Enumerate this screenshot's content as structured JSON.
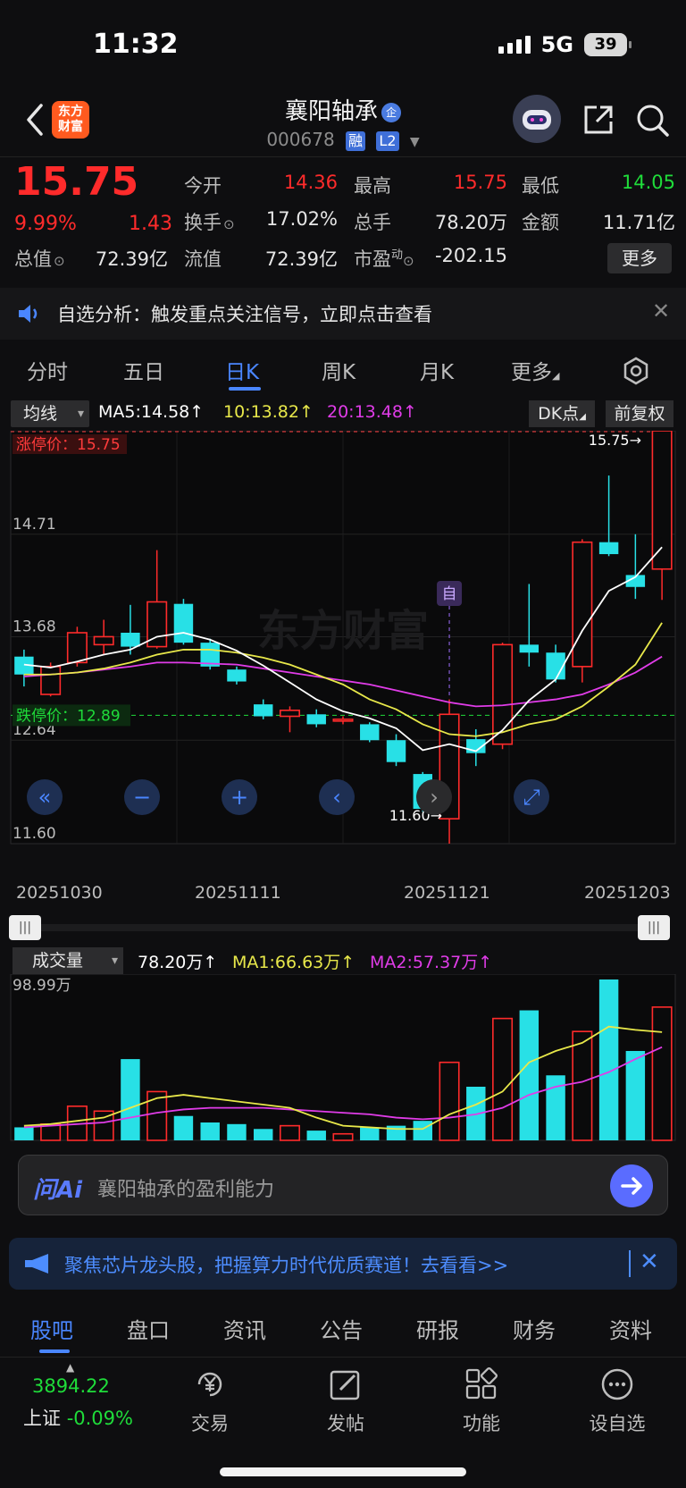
{
  "status": {
    "time": "11:32",
    "network": "5G",
    "battery": "39"
  },
  "nav": {
    "logo_line1": "东方",
    "logo_line2": "财富",
    "title": "襄阳轴承",
    "title_badge": "企",
    "code": "000678",
    "tag1": "融",
    "tag2": "L2"
  },
  "quote": {
    "price": "15.75",
    "pct": "9.99%",
    "change": "1.43",
    "open_label": "今开",
    "open": "14.36",
    "high_label": "最高",
    "high": "15.75",
    "low_label": "最低",
    "low": "14.05",
    "turnover_label": "换手",
    "turnover": "17.02%",
    "volume_label": "总手",
    "volume": "78.20万",
    "amount_label": "金额",
    "amount": "11.71亿",
    "mcap_label": "总值",
    "mcap": "72.39亿",
    "float_label": "流值",
    "float": "72.39亿",
    "pe_label": "市盈",
    "pe_sup": "动",
    "pe": "-202.15",
    "more": "更多"
  },
  "notice": {
    "text": "自选分析：触发重点关注信号，立即点击查看",
    "close": "✕"
  },
  "tabs": [
    "分时",
    "五日",
    "日K",
    "周K",
    "月K",
    "更多"
  ],
  "ma_row": {
    "select": "均线",
    "ma5": "MA5:14.58↑",
    "ma10": "10:13.82↑",
    "ma20": "20:13.48↑",
    "dk": "DK点",
    "fq": "前复权"
  },
  "kchart_labels": {
    "limit_up": "涨停价：15.75",
    "limit_down": "跌停价：12.89",
    "y1": "15.75",
    "y2": "14.71",
    "y3": "13.68",
    "y4": "12.64",
    "y5": "11.60",
    "max_mark": "15.75→",
    "min_mark": "11.60→",
    "self_mark": "自",
    "watermark": "东方财富"
  },
  "dates": [
    "20251030",
    "20251111",
    "20251121",
    "20251203"
  ],
  "chart_data": {
    "type": "candlestick",
    "ylim": [
      11.6,
      15.75
    ],
    "y_ticks": [
      15.75,
      14.71,
      13.68,
      12.64,
      11.6
    ],
    "candles": [
      {
        "o": 13.48,
        "c": 13.3,
        "h": 13.55,
        "l": 13.18
      },
      {
        "o": 13.1,
        "c": 13.38,
        "h": 13.42,
        "l": 13.08
      },
      {
        "o": 13.42,
        "c": 13.72,
        "h": 13.78,
        "l": 13.38
      },
      {
        "o": 13.6,
        "c": 13.68,
        "h": 13.85,
        "l": 13.5
      },
      {
        "o": 13.72,
        "c": 13.58,
        "h": 14.0,
        "l": 13.5
      },
      {
        "o": 13.58,
        "c": 14.03,
        "h": 14.55,
        "l": 13.56
      },
      {
        "o": 14.01,
        "c": 13.62,
        "h": 14.06,
        "l": 13.6
      },
      {
        "o": 13.62,
        "c": 13.38,
        "h": 13.66,
        "l": 13.35
      },
      {
        "o": 13.35,
        "c": 13.23,
        "h": 13.38,
        "l": 13.2
      },
      {
        "o": 13.0,
        "c": 12.88,
        "h": 13.05,
        "l": 12.85
      },
      {
        "o": 12.88,
        "c": 12.94,
        "h": 12.98,
        "l": 12.72
      },
      {
        "o": 12.9,
        "c": 12.8,
        "h": 12.95,
        "l": 12.77
      },
      {
        "o": 12.85,
        "c": 12.85,
        "h": 12.88,
        "l": 12.8
      },
      {
        "o": 12.8,
        "c": 12.64,
        "h": 12.82,
        "l": 12.62
      },
      {
        "o": 12.64,
        "c": 12.42,
        "h": 12.7,
        "l": 12.38
      },
      {
        "o": 12.3,
        "c": 11.95,
        "h": 12.32,
        "l": 11.92
      },
      {
        "o": 11.85,
        "c": 12.9,
        "h": 13.05,
        "l": 11.6
      },
      {
        "o": 12.65,
        "c": 12.51,
        "h": 12.75,
        "l": 12.38
      },
      {
        "o": 12.6,
        "c": 13.6,
        "h": 13.62,
        "l": 12.55
      },
      {
        "o": 13.6,
        "c": 13.52,
        "h": 14.21,
        "l": 13.38
      },
      {
        "o": 13.52,
        "c": 13.25,
        "h": 13.6,
        "l": 13.22
      },
      {
        "o": 13.38,
        "c": 14.63,
        "h": 14.66,
        "l": 13.22
      },
      {
        "o": 14.63,
        "c": 14.51,
        "h": 15.3,
        "l": 14.49
      },
      {
        "o": 14.3,
        "c": 14.18,
        "h": 14.71,
        "l": 14.06
      },
      {
        "o": 14.36,
        "c": 15.75,
        "h": 15.75,
        "l": 14.05
      }
    ],
    "ma5": [
      13.4,
      13.37,
      13.43,
      13.5,
      13.55,
      13.68,
      13.72,
      13.65,
      13.54,
      13.39,
      13.22,
      13.05,
      12.93,
      12.86,
      12.76,
      12.54,
      12.6,
      12.53,
      12.74,
      13.04,
      13.25,
      13.74,
      14.14,
      14.28,
      14.58
    ],
    "ma10": [
      13.3,
      13.3,
      13.32,
      13.36,
      13.42,
      13.5,
      13.55,
      13.55,
      13.52,
      13.47,
      13.4,
      13.3,
      13.2,
      13.05,
      12.95,
      12.8,
      12.7,
      12.68,
      12.72,
      12.8,
      12.85,
      12.98,
      13.18,
      13.4,
      13.82
    ],
    "ma20": [
      13.28,
      13.3,
      13.32,
      13.35,
      13.38,
      13.42,
      13.42,
      13.41,
      13.4,
      13.36,
      13.32,
      13.28,
      13.24,
      13.2,
      13.14,
      13.08,
      13.02,
      12.98,
      12.99,
      13.02,
      13.05,
      13.1,
      13.2,
      13.32,
      13.48
    ],
    "vol_ylim": [
      0,
      98.99
    ],
    "volume": [
      8,
      10,
      21,
      18,
      50,
      30,
      15,
      11,
      10,
      7,
      9,
      6,
      4,
      8,
      9,
      12,
      48,
      33,
      75,
      80,
      40,
      67,
      98.99,
      55,
      82
    ],
    "vol_ma1": [
      9,
      10,
      12,
      14,
      20,
      26,
      28,
      26,
      24,
      22,
      20,
      14,
      9,
      8,
      7,
      7,
      16,
      22,
      30,
      48,
      55,
      60,
      70,
      68,
      66.63
    ],
    "vol_ma2": [
      8,
      9,
      10,
      11,
      14,
      17,
      19,
      20,
      20,
      20,
      19,
      18,
      17,
      16,
      14,
      13,
      14,
      16,
      20,
      28,
      33,
      36,
      42,
      50,
      57.37
    ]
  },
  "vol_row": {
    "select": "成交量",
    "vol": "78.20万↑",
    "ma1": "MA1:66.63万↑",
    "ma2": "MA2:57.37万↑",
    "ymax": "98.99万"
  },
  "ai": {
    "logo": "问Ai",
    "placeholder": "襄阳轴承的盈利能力"
  },
  "promo": {
    "text": "聚焦芯片龙头股，把握算力时代优质赛道！去看看>>",
    "close": "✕"
  },
  "bottom_tabs": [
    "股吧",
    "盘口",
    "资讯",
    "公告",
    "研报",
    "财务",
    "资料"
  ],
  "toolbar": {
    "index_value": "3894.22",
    "index_name": "上证",
    "index_pct": "-0.09%",
    "trade": "交易",
    "post": "发帖",
    "func": "功能",
    "add": "设自选"
  },
  "colors": {
    "up": "#ff2b2b",
    "down": "#28e0e6",
    "ma5": "#ffffff",
    "ma10": "#e8e84a",
    "ma20": "#e03ce8",
    "accent": "#4a86ff"
  }
}
